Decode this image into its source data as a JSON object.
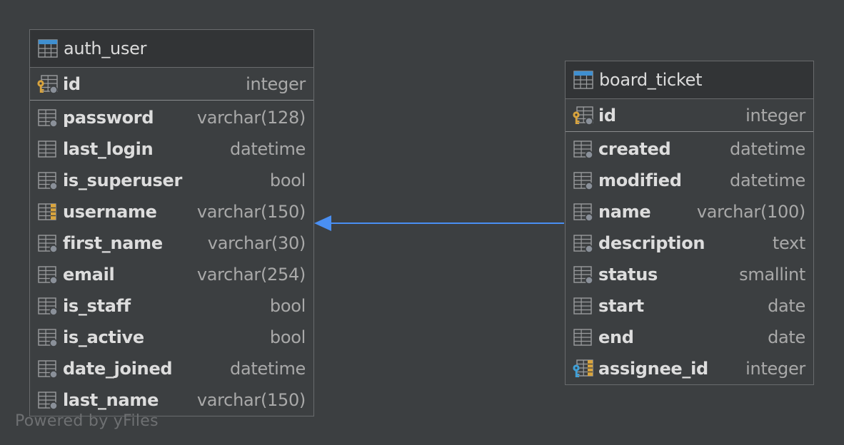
{
  "tables": [
    {
      "id": "auth",
      "title": "auth_user",
      "pk": {
        "name": "id",
        "type": "integer",
        "icon": "primary-key-icon"
      },
      "columns": [
        {
          "name": "password",
          "type": "varchar(128)",
          "icon": "column-required-icon"
        },
        {
          "name": "last_login",
          "type": "datetime",
          "icon": "column-icon"
        },
        {
          "name": "is_superuser",
          "type": "bool",
          "icon": "column-required-icon"
        },
        {
          "name": "username",
          "type": "varchar(150)",
          "icon": "unique-column-icon"
        },
        {
          "name": "first_name",
          "type": "varchar(30)",
          "icon": "column-required-icon"
        },
        {
          "name": "email",
          "type": "varchar(254)",
          "icon": "column-required-icon"
        },
        {
          "name": "is_staff",
          "type": "bool",
          "icon": "column-required-icon"
        },
        {
          "name": "is_active",
          "type": "bool",
          "icon": "column-required-icon"
        },
        {
          "name": "date_joined",
          "type": "datetime",
          "icon": "column-required-icon"
        },
        {
          "name": "last_name",
          "type": "varchar(150)",
          "icon": "column-required-icon"
        }
      ]
    },
    {
      "id": "board",
      "title": "board_ticket",
      "pk": {
        "name": "id",
        "type": "integer",
        "icon": "primary-key-icon"
      },
      "columns": [
        {
          "name": "created",
          "type": "datetime",
          "icon": "column-required-icon"
        },
        {
          "name": "modified",
          "type": "datetime",
          "icon": "column-required-icon"
        },
        {
          "name": "name",
          "type": "varchar(100)",
          "icon": "column-required-icon"
        },
        {
          "name": "description",
          "type": "text",
          "icon": "column-required-icon"
        },
        {
          "name": "status",
          "type": "smallint",
          "icon": "column-required-icon"
        },
        {
          "name": "start",
          "type": "date",
          "icon": "column-icon"
        },
        {
          "name": "end",
          "type": "date",
          "icon": "column-icon"
        },
        {
          "name": "assignee_id",
          "type": "integer",
          "icon": "foreign-key-icon"
        }
      ]
    }
  ],
  "edge": {
    "from": "board_ticket.assignee_id",
    "to": "auth_user.id",
    "color": "#4a8ff2"
  },
  "watermark": "Powered by yFiles",
  "colors": {
    "background": "#3c3f41",
    "header": "#323436",
    "border": "#696b6d",
    "table_icon_accent": "#3f8fd0",
    "key_gold": "#d9a43d",
    "key_blue": "#3fa0d8"
  }
}
